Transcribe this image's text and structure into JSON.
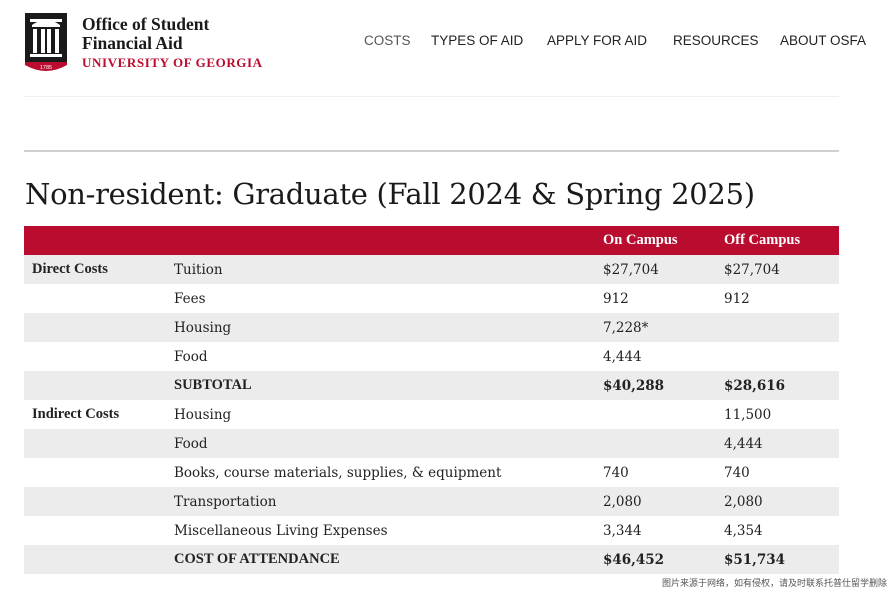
{
  "header": {
    "org_line1": "Office of Student",
    "org_line2": "Financial Aid",
    "university": "UNIVERSITY OF GEORGIA",
    "logo_year": "1785",
    "brand_color": "#ba0c2f"
  },
  "nav": {
    "items": [
      {
        "label": "COSTS",
        "active": true
      },
      {
        "label": "TYPES OF AID",
        "active": false
      },
      {
        "label": "APPLY FOR AID",
        "active": false
      },
      {
        "label": "RESOURCES",
        "active": false
      },
      {
        "label": "ABOUT OSFA",
        "active": false
      }
    ]
  },
  "page": {
    "title": "Non-resident: Graduate (Fall 2024 & Spring 2025)"
  },
  "table": {
    "headers": [
      "",
      "",
      "On Campus",
      "Off Campus"
    ],
    "rows": [
      {
        "group": "Direct Costs",
        "item": "Tuition",
        "on": "$27,704",
        "off": "$27,704"
      },
      {
        "group": "",
        "item": "Fees",
        "on": "912",
        "off": "912"
      },
      {
        "group": "",
        "item": "Housing",
        "on": "7,228*",
        "off": ""
      },
      {
        "group": "",
        "item": "Food",
        "on": "4,444",
        "off": ""
      },
      {
        "group": "",
        "item": "SUBTOTAL",
        "on": "$40,288",
        "off": "$28,616"
      },
      {
        "group": "Indirect Costs",
        "item": "Housing",
        "on": "",
        "off": "11,500"
      },
      {
        "group": "",
        "item": "Food",
        "on": "",
        "off": "4,444"
      },
      {
        "group": "",
        "item": "Books, course materials, supplies, & equipment",
        "on": "740",
        "off": "740"
      },
      {
        "group": "",
        "item": "Transportation",
        "on": "2,080",
        "off": "2,080"
      },
      {
        "group": "",
        "item": "Miscellaneous Living Expenses",
        "on": "3,344",
        "off": "4,354"
      },
      {
        "group": "",
        "item": "COST OF ATTENDANCE",
        "on": "$46,452",
        "off": "$51,734"
      }
    ]
  },
  "watermark": "图片来源于网络，如有侵权，请及时联系托普仕留学删除"
}
